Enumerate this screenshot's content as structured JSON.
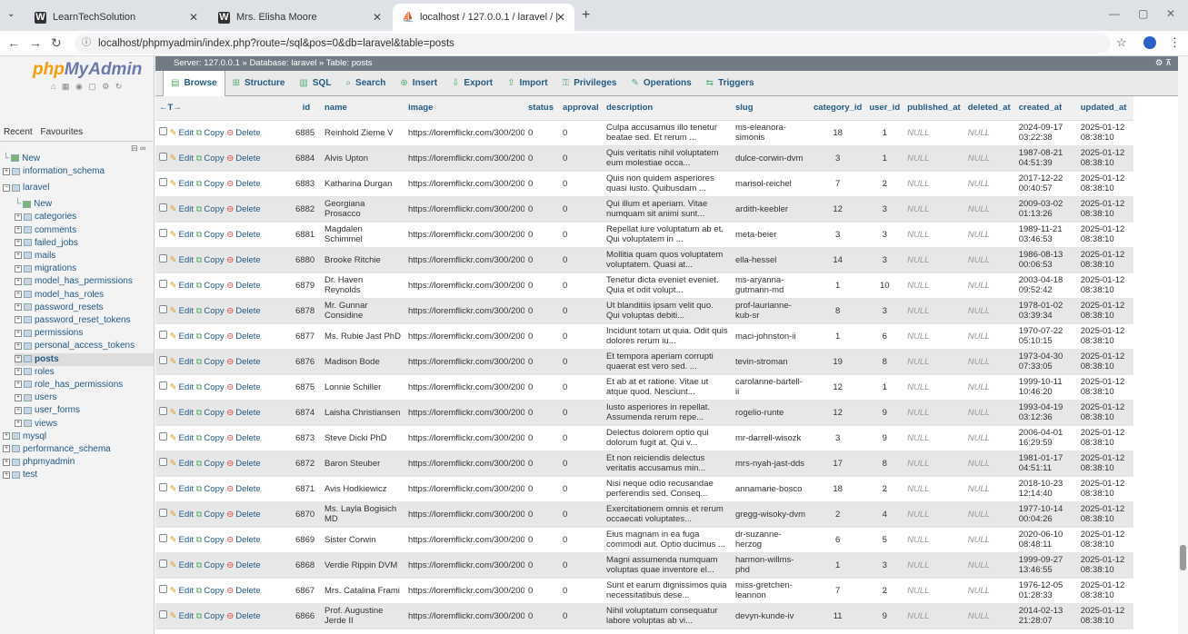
{
  "browser": {
    "tabs": [
      {
        "title": "LearnTechSolution",
        "icon": "W"
      },
      {
        "title": "Mrs. Elisha Moore",
        "icon": "W"
      },
      {
        "title": "localhost / 127.0.0.1 / laravel / |",
        "icon": "pma"
      }
    ],
    "new_tab": "+",
    "url": "localhost/phpmyadmin/index.php?route=/sql&pos=0&db=laravel&table=posts"
  },
  "sidebar": {
    "logo_php": "php",
    "logo_myadmin": "MyAdmin",
    "recent": "Recent",
    "favourites": "Favourites",
    "tree": [
      {
        "label": "New",
        "level": 0
      },
      {
        "label": "information_schema",
        "level": 0
      },
      {
        "label": "laravel",
        "level": 0
      },
      {
        "label": "New",
        "level": 1
      },
      {
        "label": "categories",
        "level": 1
      },
      {
        "label": "comments",
        "level": 1
      },
      {
        "label": "failed_jobs",
        "level": 1
      },
      {
        "label": "mails",
        "level": 1
      },
      {
        "label": "migrations",
        "level": 1
      },
      {
        "label": "model_has_permissions",
        "level": 1
      },
      {
        "label": "model_has_roles",
        "level": 1
      },
      {
        "label": "password_resets",
        "level": 1
      },
      {
        "label": "password_reset_tokens",
        "level": 1
      },
      {
        "label": "permissions",
        "level": 1
      },
      {
        "label": "personal_access_tokens",
        "level": 1
      },
      {
        "label": "posts",
        "level": 1
      },
      {
        "label": "roles",
        "level": 1
      },
      {
        "label": "role_has_permissions",
        "level": 1
      },
      {
        "label": "users",
        "level": 1
      },
      {
        "label": "user_forms",
        "level": 1
      },
      {
        "label": "views",
        "level": 1
      },
      {
        "label": "mysql",
        "level": 0
      },
      {
        "label": "performance_schema",
        "level": 0
      },
      {
        "label": "phpmyadmin",
        "level": 0
      },
      {
        "label": "test",
        "level": 0
      }
    ]
  },
  "breadcrumb": "Server: 127.0.0.1 » Database: laravel » Table: posts",
  "menu": [
    "Browse",
    "Structure",
    "SQL",
    "Search",
    "Insert",
    "Export",
    "Import",
    "Privileges",
    "Operations",
    "Triggers"
  ],
  "table": {
    "columns": [
      "id",
      "name",
      "image",
      "status",
      "approval",
      "description",
      "slug",
      "category_id",
      "user_id",
      "published_at",
      "deleted_at",
      "created_at",
      "updated_at"
    ],
    "actions": {
      "edit": "Edit",
      "copy": "Copy",
      "delete": "Delete"
    },
    "rows": [
      [
        "6885",
        "Reinhold Zieme V",
        "https://loremflickr.com/300/200/",
        "0",
        "0",
        "Culpa accusamus illo tenetur beatae sed. Et rerum ...",
        "ms-eleanora-simonis",
        "18",
        "1",
        "NULL",
        "NULL",
        "2024-09-17 03:22:38",
        "2025-01-12 08:38:10"
      ],
      [
        "6884",
        "Alvis Upton",
        "https://loremflickr.com/300/200/",
        "0",
        "0",
        "Quis veritatis nihil voluptatem eum molestiae occa...",
        "dulce-corwin-dvm",
        "3",
        "1",
        "NULL",
        "NULL",
        "1987-08-21 04:51:39",
        "2025-01-12 08:38:10"
      ],
      [
        "6883",
        "Katharina Durgan",
        "https://loremflickr.com/300/200/",
        "0",
        "0",
        "Quis non quidem asperiores quasi iusto. Quibusdam ...",
        "marisol-reichel",
        "7",
        "2",
        "NULL",
        "NULL",
        "2017-12-22 00:40:57",
        "2025-01-12 08:38:10"
      ],
      [
        "6882",
        "Georgiana Prosacco",
        "https://loremflickr.com/300/200/",
        "0",
        "0",
        "Qui illum et aperiam. Vitae numquam sit animi sunt...",
        "ardith-keebler",
        "12",
        "3",
        "NULL",
        "NULL",
        "2009-03-02 01:13:26",
        "2025-01-12 08:38:10"
      ],
      [
        "6881",
        "Magdalen Schimmel",
        "https://loremflickr.com/300/200/",
        "0",
        "0",
        "Repellat iure voluptatum ab et. Qui voluptatem in ...",
        "meta-beier",
        "3",
        "3",
        "NULL",
        "NULL",
        "1989-11-21 03:46:53",
        "2025-01-12 08:38:10"
      ],
      [
        "6880",
        "Brooke Ritchie",
        "https://loremflickr.com/300/200/",
        "0",
        "0",
        "Mollitia quam quos voluptatem voluptatem. Quasi at...",
        "ella-hessel",
        "14",
        "3",
        "NULL",
        "NULL",
        "1986-08-13 00:06:53",
        "2025-01-12 08:38:10"
      ],
      [
        "6879",
        "Dr. Haven Reynolds",
        "https://loremflickr.com/300/200/",
        "0",
        "0",
        "Tenetur dicta eveniet eveniet. Quia et odit volupt...",
        "ms-aryanna-gutmann-md",
        "1",
        "10",
        "NULL",
        "NULL",
        "2003-04-18 09:52:42",
        "2025-01-12 08:38:10"
      ],
      [
        "6878",
        "Mr. Gunnar Considine",
        "https://loremflickr.com/300/200/",
        "0",
        "0",
        "Ut blanditiis ipsam velit quo. Qui voluptas debiti...",
        "prof-laurianne-kub-sr",
        "8",
        "3",
        "NULL",
        "NULL",
        "1978-01-02 03:39:34",
        "2025-01-12 08:38:10"
      ],
      [
        "6877",
        "Ms. Rubie Jast PhD",
        "https://loremflickr.com/300/200/",
        "0",
        "0",
        "Incidunt totam ut quia. Odit quis dolores rerum iu...",
        "maci-johnston-ii",
        "1",
        "6",
        "NULL",
        "NULL",
        "1970-07-22 05:10:15",
        "2025-01-12 08:38:10"
      ],
      [
        "6876",
        "Madison Bode",
        "https://loremflickr.com/300/200/",
        "0",
        "0",
        "Et tempora aperiam corrupti quaerat est vero sed. ...",
        "tevin-stroman",
        "19",
        "8",
        "NULL",
        "NULL",
        "1973-04-30 07:33:05",
        "2025-01-12 08:38:10"
      ],
      [
        "6875",
        "Lonnie Schiller",
        "https://loremflickr.com/300/200/",
        "0",
        "0",
        "Et ab at et ratione. Vitae ut atque quod. Nesciunt...",
        "carolanne-bartell-ii",
        "12",
        "1",
        "NULL",
        "NULL",
        "1999-10-11 10:46:20",
        "2025-01-12 08:38:10"
      ],
      [
        "6874",
        "Laisha Christiansen",
        "https://loremflickr.com/300/200/",
        "0",
        "0",
        "Iusto asperiores in repellat. Assumenda rerum repe...",
        "rogelio-runte",
        "12",
        "9",
        "NULL",
        "NULL",
        "1993-04-19 03:12:36",
        "2025-01-12 08:38:10"
      ],
      [
        "6873",
        "Steve Dicki PhD",
        "https://loremflickr.com/300/200/",
        "0",
        "0",
        "Delectus dolorem optio qui dolorum fugit at. Qui v...",
        "mr-darrell-wisozk",
        "3",
        "9",
        "NULL",
        "NULL",
        "2006-04-01 16:29:59",
        "2025-01-12 08:38:10"
      ],
      [
        "6872",
        "Baron Steuber",
        "https://loremflickr.com/300/200/",
        "0",
        "0",
        "Et non reiciendis delectus veritatis accusamus min...",
        "mrs-nyah-jast-dds",
        "17",
        "8",
        "NULL",
        "NULL",
        "1981-01-17 04:51:11",
        "2025-01-12 08:38:10"
      ],
      [
        "6871",
        "Avis Hodkiewicz",
        "https://loremflickr.com/300/200/",
        "0",
        "0",
        "Nisi neque odio recusandae perferendis sed. Conseq...",
        "annamarie-bosco",
        "18",
        "2",
        "NULL",
        "NULL",
        "2018-10-23 12:14:40",
        "2025-01-12 08:38:10"
      ],
      [
        "6870",
        "Ms. Layla Bogisich MD",
        "https://loremflickr.com/300/200/",
        "0",
        "0",
        "Exercitationem omnis et rerum occaecati voluptates...",
        "gregg-wisoky-dvm",
        "2",
        "4",
        "NULL",
        "NULL",
        "1977-10-14 00:04:26",
        "2025-01-12 08:38:10"
      ],
      [
        "6869",
        "Sister Corwin",
        "https://loremflickr.com/300/200/",
        "0",
        "0",
        "Eius magnam in ea fuga commodi aut. Optio ducimus ...",
        "dr-suzanne-herzog",
        "6",
        "5",
        "NULL",
        "NULL",
        "2020-06-10 08:48:11",
        "2025-01-12 08:38:10"
      ],
      [
        "6868",
        "Verdie Rippin DVM",
        "https://loremflickr.com/300/200/",
        "0",
        "0",
        "Magni assumenda numquam voluptas quae inventore el...",
        "harmon-willms-phd",
        "1",
        "3",
        "NULL",
        "NULL",
        "1999-09-27 13:46:55",
        "2025-01-12 08:38:10"
      ],
      [
        "6867",
        "Mrs. Catalina Frami",
        "https://loremflickr.com/300/200/",
        "0",
        "0",
        "Sunt et earum dignissimos quia necessitatibus dese...",
        "miss-gretchen-leannon",
        "7",
        "2",
        "NULL",
        "NULL",
        "1976-12-05 01:28:33",
        "2025-01-12 08:38:10"
      ],
      [
        "6866",
        "Prof. Augustine Jerde II",
        "https://loremflickr.com/300/200/",
        "0",
        "0",
        "Nihil voluptatum consequatur labore voluptas ab vi...",
        "devyn-kunde-iv",
        "11",
        "9",
        "NULL",
        "NULL",
        "2014-02-13 21:28:07",
        "2025-01-12 08:38:10"
      ]
    ]
  }
}
